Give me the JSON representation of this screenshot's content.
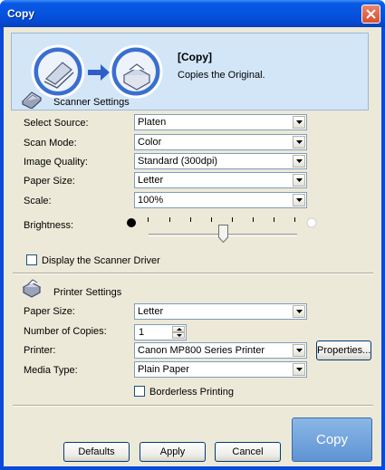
{
  "window": {
    "title": "Copy"
  },
  "banner": {
    "title": "[Copy]",
    "subtitle": "Copies the Original."
  },
  "scanner": {
    "header": "Scanner Settings",
    "fields": [
      {
        "label": "Select Source:",
        "value": "Platen"
      },
      {
        "label": "Scan Mode:",
        "value": "Color"
      },
      {
        "label": "Image Quality:",
        "value": "Standard (300dpi)"
      },
      {
        "label": "Paper Size:",
        "value": "Letter"
      },
      {
        "label": "Scale:",
        "value": "100%"
      }
    ],
    "brightness_label": "Brightness:",
    "brightness_level": 0.5,
    "display_driver_label": "Display the Scanner Driver",
    "display_driver_checked": false
  },
  "printer": {
    "header": "Printer Settings",
    "paper_size_label": "Paper Size:",
    "paper_size_value": "Letter",
    "copies_label": "Number of Copies:",
    "copies_value": "1",
    "printer_label": "Printer:",
    "printer_value": "Canon MP800 Series Printer",
    "properties_label": "Properties...",
    "media_label": "Media Type:",
    "media_value": "Plain Paper",
    "borderless_label": "Borderless Printing",
    "borderless_checked": false
  },
  "buttons": {
    "defaults": "Defaults",
    "apply": "Apply",
    "cancel": "Cancel",
    "copy": "Copy"
  },
  "colors": {
    "titlebar": "#0553df",
    "client": "#ece9d8",
    "banner": "#d3e6f8",
    "copy_button": "#6b9bd8"
  }
}
